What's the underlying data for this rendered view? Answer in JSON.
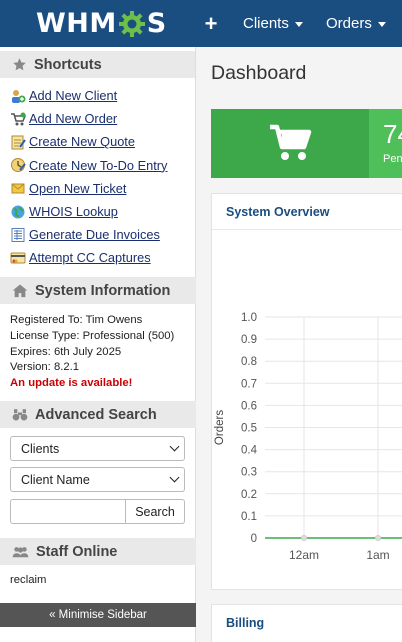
{
  "app": {
    "logo_text_left": "WHM",
    "logo_text_right": "S"
  },
  "nav": {
    "plus": "+",
    "clients": "Clients",
    "orders": "Orders"
  },
  "sidebar": {
    "shortcuts_title": "Shortcuts",
    "shortcuts": [
      {
        "label": "Add New Client",
        "icon": "add-client-icon"
      },
      {
        "label": "Add New Order",
        "icon": "cart-icon"
      },
      {
        "label": "Create New Quote",
        "icon": "quote-icon"
      },
      {
        "label": "Create New To-Do Entry",
        "icon": "todo-icon"
      },
      {
        "label": "Open New Ticket",
        "icon": "ticket-icon"
      },
      {
        "label": "WHOIS Lookup",
        "icon": "globe-icon"
      },
      {
        "label": "Generate Due Invoices",
        "icon": "invoice-icon"
      },
      {
        "label": "Attempt CC Captures",
        "icon": "credit-card-icon"
      }
    ],
    "system_title": "System Information",
    "system": {
      "registered": "Registered To: Tim Owens",
      "license": "License Type: Professional (500)",
      "expires": "Expires: 6th July 2025",
      "version": "Version: 8.2.1",
      "update": "An update is available!"
    },
    "search_title": "Advanced Search",
    "search": {
      "type_value": "Clients",
      "field_value": "Client Name",
      "button": "Search"
    },
    "staff_title": "Staff Online",
    "staff_name": "reclaim",
    "minimise": "« Minimise Sidebar"
  },
  "main": {
    "title": "Dashboard",
    "tile_number": "74",
    "tile_label": "Pen",
    "overview_title": "System Overview",
    "billing_title": "Billing"
  },
  "chart_data": {
    "type": "line",
    "title": "",
    "xlabel": "",
    "ylabel": "Orders",
    "categories": [
      "12am",
      "1am"
    ],
    "y_ticks": [
      "1.0",
      "0.9",
      "0.8",
      "0.7",
      "0.6",
      "0.5",
      "0.4",
      "0.3",
      "0.2",
      "0.1",
      "0"
    ],
    "ylim": [
      0,
      1.0
    ],
    "series": [
      {
        "values": [
          0,
          0
        ],
        "color": "#3da84a"
      }
    ],
    "grid": true
  },
  "colors": {
    "topbar": "#1a4d80",
    "green": "#3da84a",
    "update_red": "#cc0000"
  }
}
